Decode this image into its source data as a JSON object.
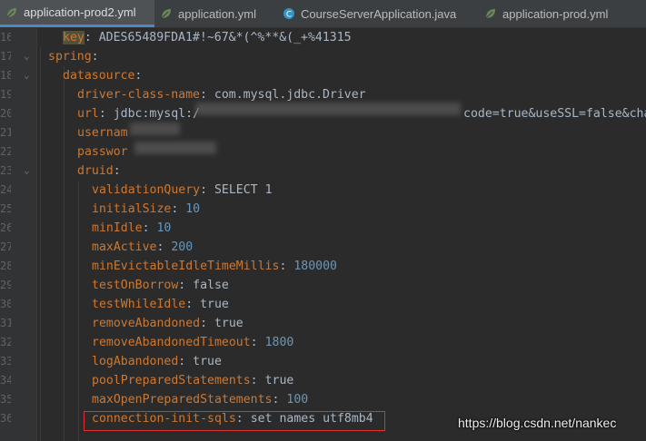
{
  "tabs": [
    {
      "label": "application-prod2.yml",
      "active": true,
      "icon": "yml-leaf-icon"
    },
    {
      "label": "application.yml",
      "active": false,
      "icon": "yml-leaf-icon"
    },
    {
      "label": "CourseServerApplication.java",
      "active": false,
      "icon": "spring-class-icon"
    },
    {
      "label": "application-prod.yml",
      "active": false,
      "icon": "yml-leaf-icon"
    }
  ],
  "lines": [
    {
      "num": "16",
      "key": "key",
      "val": "ADES65489FDA1#!~67&*(^%**&(_+%41315",
      "type": "str",
      "highlight": true
    },
    {
      "num": "17",
      "key": "spring",
      "val": "",
      "type": "str"
    },
    {
      "num": "18",
      "key": "datasource",
      "val": "",
      "type": "str"
    },
    {
      "num": "19",
      "key": "driver-class-name",
      "val": "com.mysql.jdbc.Driver",
      "type": "str"
    },
    {
      "num": "20",
      "key": "url",
      "val": "jdbc:mysql:/",
      "tail": "code=true&useSSL=false&cha",
      "type": "str"
    },
    {
      "num": "21",
      "key": "usernam",
      "val": "",
      "type": "str",
      "nocolon": true
    },
    {
      "num": "22",
      "key": "passwor",
      "val": "",
      "type": "str",
      "nocolon": true
    },
    {
      "num": "23",
      "key": "druid",
      "val": "",
      "type": "str"
    },
    {
      "num": "24",
      "key": "validationQuery",
      "val": "SELECT 1",
      "type": "str"
    },
    {
      "num": "25",
      "key": "initialSize",
      "val": "10",
      "type": "num"
    },
    {
      "num": "26",
      "key": "minIdle",
      "val": "10",
      "type": "num"
    },
    {
      "num": "27",
      "key": "maxActive",
      "val": "200",
      "type": "num"
    },
    {
      "num": "28",
      "key": "minEvictableIdleTimeMillis",
      "val": "180000",
      "type": "num"
    },
    {
      "num": "29",
      "key": "testOnBorrow",
      "val": "false",
      "type": "str"
    },
    {
      "num": "30",
      "key": "testWhileIdle",
      "val": "true",
      "type": "str"
    },
    {
      "num": "31",
      "key": "removeAbandoned",
      "val": "true",
      "type": "str"
    },
    {
      "num": "32",
      "key": "removeAbandonedTimeout",
      "val": "1800",
      "type": "num"
    },
    {
      "num": "33",
      "key": "logAbandoned",
      "val": "true",
      "type": "str"
    },
    {
      "num": "34",
      "key": "poolPreparedStatements",
      "val": "true",
      "type": "str"
    },
    {
      "num": "35",
      "key": "maxOpenPreparedStatements",
      "val": "100",
      "type": "num"
    },
    {
      "num": "36",
      "key": "connection-init-sqls",
      "val": "set names utf8mb4",
      "type": "str"
    }
  ],
  "watermark": "https://blog.csdn.net/nankec",
  "colors": {
    "key": "#cc7832",
    "string": "#a9b7c6",
    "number": "#6897bb",
    "background": "#2b2b2b",
    "highlight_box": "#e03030"
  }
}
